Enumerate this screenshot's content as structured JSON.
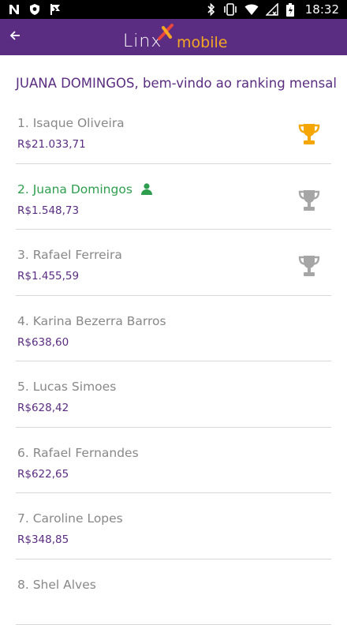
{
  "status_bar": {
    "time": "18:32",
    "left_icons": [
      "n-icon",
      "shield-icon",
      "flag-icon"
    ],
    "right_icons": [
      "bluetooth-icon",
      "vibrate-icon",
      "wifi-icon",
      "no-signal-icon",
      "battery-icon"
    ]
  },
  "app_bar": {
    "logo_linx": "Linx",
    "logo_mobile": "mobile",
    "brand_color": "#5a2d82",
    "accent_color": "#f5a623"
  },
  "welcome_message": "JUANA DOMINGOS, bem-vindo ao ranking mensal",
  "ranking": [
    {
      "name": "1. Isaque Oliveira",
      "value": "R$21.033,71",
      "trophy": "gold",
      "current_user": false
    },
    {
      "name": "2. Juana Domingos",
      "value": "R$1.548,73",
      "trophy": "silver",
      "current_user": true
    },
    {
      "name": "3. Rafael Ferreira",
      "value": "R$1.455,59",
      "trophy": "silver",
      "current_user": false
    },
    {
      "name": "4. Karina Bezerra Barros",
      "value": "R$638,60",
      "trophy": null,
      "current_user": false
    },
    {
      "name": "5. Lucas Simoes",
      "value": "R$628,42",
      "trophy": null,
      "current_user": false
    },
    {
      "name": "6. Rafael Fernandes",
      "value": "R$622,65",
      "trophy": null,
      "current_user": false
    },
    {
      "name": "7. Caroline Lopes",
      "value": "R$348,85",
      "trophy": null,
      "current_user": false
    },
    {
      "name": "8. Shel Alves",
      "value": "",
      "trophy": null,
      "current_user": false
    }
  ],
  "colors": {
    "gold_trophy": "#f5a600",
    "silver_trophy": "#a6a6a6",
    "current_user": "#2e9e4e"
  }
}
